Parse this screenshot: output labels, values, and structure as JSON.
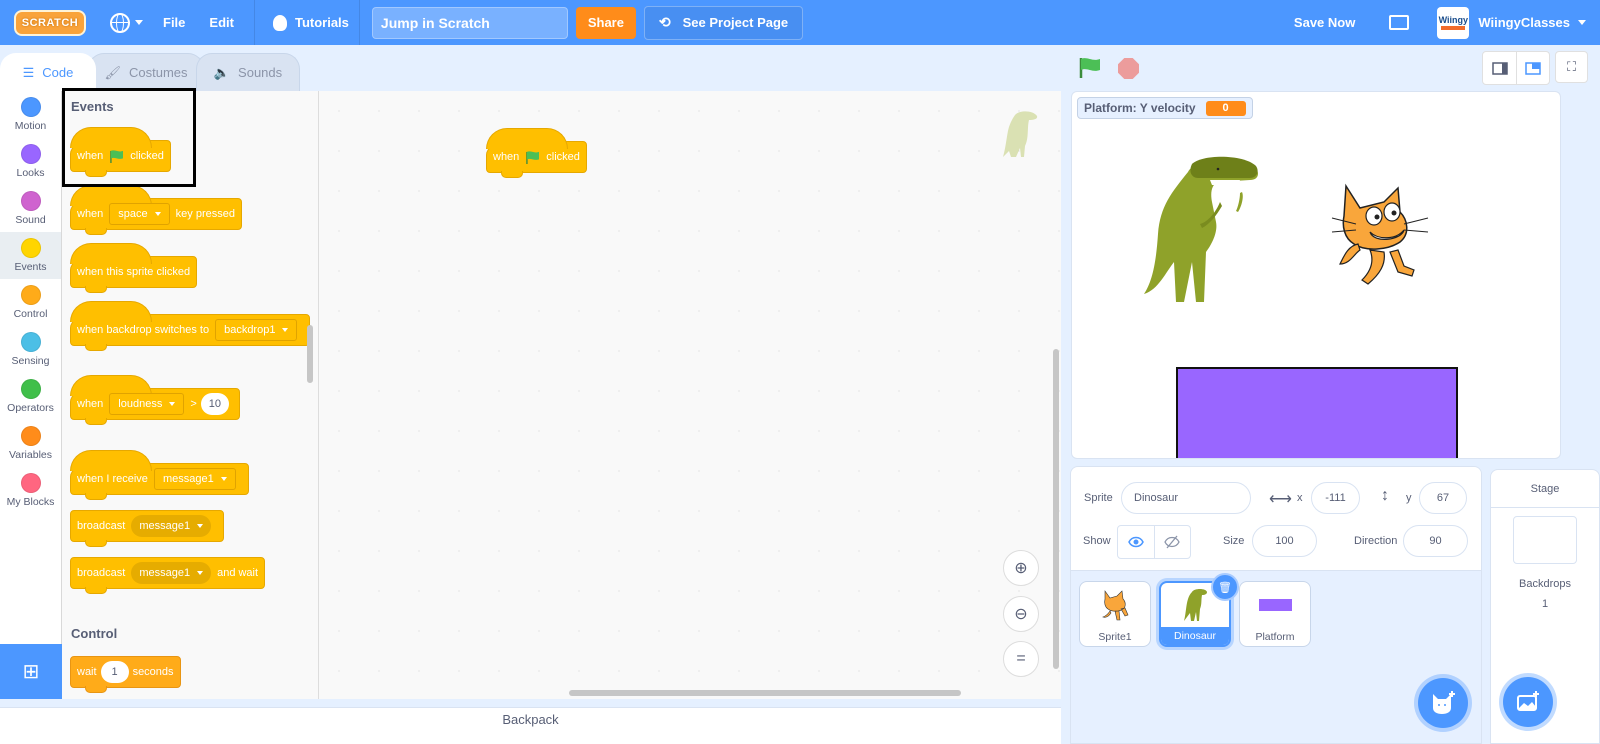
{
  "menubar": {
    "logo": "SCRATCH",
    "file": "File",
    "edit": "Edit",
    "tutorials": "Tutorials",
    "project_title": "Jump in Scratch",
    "share": "Share",
    "see_project_page": "See Project Page",
    "save_now": "Save Now",
    "avatar_text": "Wiingy",
    "username": "WiingyClasses"
  },
  "tabs": [
    {
      "label": "Code",
      "active": true
    },
    {
      "label": "Costumes",
      "active": false
    },
    {
      "label": "Sounds",
      "active": false
    }
  ],
  "categories": [
    {
      "label": "Motion",
      "color": "#4c97ff"
    },
    {
      "label": "Looks",
      "color": "#9966ff"
    },
    {
      "label": "Sound",
      "color": "#cf63cf"
    },
    {
      "label": "Events",
      "color": "#ffd500",
      "active": true
    },
    {
      "label": "Control",
      "color": "#ffab19"
    },
    {
      "label": "Sensing",
      "color": "#4cbfe6"
    },
    {
      "label": "Operators",
      "color": "#40bf4a"
    },
    {
      "label": "Variables",
      "color": "#ff8c1a"
    },
    {
      "label": "My Blocks",
      "color": "#ff6680"
    }
  ],
  "palette": {
    "events_heading": "Events",
    "control_heading": "Control",
    "blocks": {
      "flag_clicked": {
        "pre": "when",
        "post": "clicked"
      },
      "key_pressed": {
        "pre": "when",
        "dropdown": "space",
        "post": "key pressed"
      },
      "sprite_clicked": {
        "text": "when this sprite clicked"
      },
      "backdrop_switches": {
        "pre": "when backdrop switches to",
        "dropdown": "backdrop1"
      },
      "loudness": {
        "pre": "when",
        "dropdown": "loudness",
        "op": ">",
        "value": "10"
      },
      "receive": {
        "pre": "when I receive",
        "dropdown": "message1"
      },
      "broadcast": {
        "pre": "broadcast",
        "dropdown": "message1"
      },
      "broadcast_wait": {
        "pre": "broadcast",
        "dropdown": "message1",
        "post": "and wait"
      },
      "wait": {
        "pre": "wait",
        "value": "1",
        "post": "seconds"
      }
    }
  },
  "workspace": {
    "script_block": {
      "pre": "when",
      "post": "clicked"
    },
    "backpack": "Backpack"
  },
  "stage": {
    "monitor_label": "Platform: Y velocity",
    "monitor_value": "0"
  },
  "sprite_info": {
    "sprite_label": "Sprite",
    "sprite_name": "Dinosaur",
    "x_label": "x",
    "x_value": "-111",
    "y_label": "y",
    "y_value": "67",
    "show_label": "Show",
    "size_label": "Size",
    "size_value": "100",
    "direction_label": "Direction",
    "direction_value": "90"
  },
  "sprites": [
    {
      "name": "Sprite1",
      "selected": false
    },
    {
      "name": "Dinosaur",
      "selected": true
    },
    {
      "name": "Platform",
      "selected": false
    }
  ],
  "stage_panel": {
    "label": "Stage",
    "backdrops_label": "Backdrops",
    "backdrops_count": "1"
  }
}
